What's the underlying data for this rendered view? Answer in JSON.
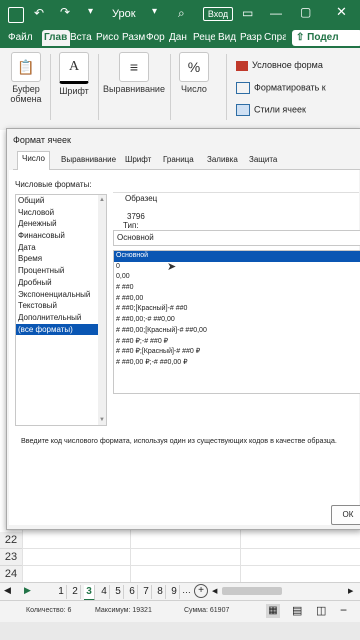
{
  "titlebar": {
    "autosave_state": "",
    "file_title": "Урок",
    "signin_label": "Вход"
  },
  "ribbon_tabs": [
    "Файл",
    "Глав",
    "Вста",
    "Рисо",
    "Разм",
    "Фор",
    "Дан",
    "Реце",
    "Вид",
    "Разр",
    "Спра"
  ],
  "share_label": "Подел",
  "ribbon": {
    "clipboard_label": "Буфер обмена",
    "font_label": "Шрифт",
    "font_icon_letter": "A",
    "align_label": "Выравнивание",
    "number_label": "Число",
    "number_icon": "%",
    "conditional_label": "Условное форма",
    "format_table_label": "Форматировать к",
    "cell_styles_label": "Стили ячеек"
  },
  "dialog": {
    "title": "Формат ячеек",
    "tabs": [
      "Число",
      "Выравнивание",
      "Шрифт",
      "Граница",
      "Заливка",
      "Защита"
    ],
    "categories_label": "Числовые форматы:",
    "categories": [
      "Общий",
      "Числовой",
      "Денежный",
      "Финансовый",
      "Дата",
      "Время",
      "Процентный",
      "Дробный",
      "Экспоненциальный",
      "Текстовый",
      "Дополнительный",
      "(все форматы)"
    ],
    "sample_label": "Образец",
    "sample_value": "3796",
    "type_label": "Тип:",
    "type_value": "Основной",
    "codes": [
      "Основной",
      "0",
      "0,00",
      "# ##0",
      "# ##0,00",
      "# ##0;[Красный]-# ##0",
      "# ##0,00;-# ##0,00",
      "# ##0,00;[Красный]-# ##0,00",
      "# ##0 ₽;-# ##0 ₽",
      "# ##0 ₽;[Красный]-# ##0 ₽",
      "# ##0,00 ₽;-# ##0,00 ₽"
    ],
    "hint": "Введите код числового формата, используя один из существующих кодов в качестве образца.",
    "ok_label": "ОК"
  },
  "row_numbers": [
    "22",
    "23",
    "24"
  ],
  "sheet_tabs": [
    "1",
    "2",
    "3",
    "4",
    "5",
    "6",
    "7",
    "8",
    "9"
  ],
  "status": {
    "count": "Количество: 6",
    "max": "Максимум: 19321",
    "sum": "Сумма: 61907"
  },
  "colors": {
    "brand": "#217346",
    "selection": "#0a56b3"
  }
}
